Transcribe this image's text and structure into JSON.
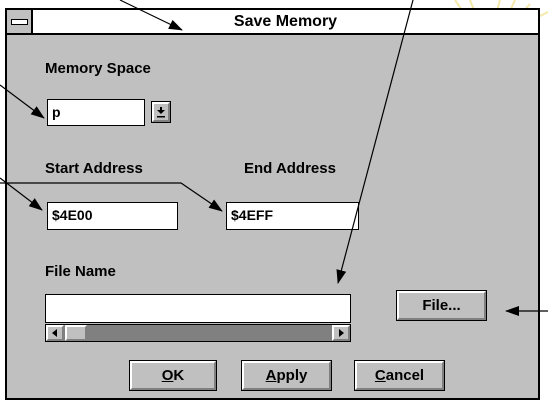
{
  "window": {
    "title": "Save Memory"
  },
  "memory_space": {
    "label": "Memory Space",
    "value": "p"
  },
  "start_address": {
    "label": "Start Address",
    "value": "$4E00"
  },
  "end_address": {
    "label": "End Address",
    "value": "$4EFF"
  },
  "file_name": {
    "label": "File Name",
    "value": ""
  },
  "buttons": {
    "file": "File...",
    "ok_mnemonic": "O",
    "ok_rest": "K",
    "apply_mnemonic": "A",
    "apply_rest": "pply",
    "cancel_mnemonic": "C",
    "cancel_rest": "ancel"
  },
  "icons": {
    "system_menu": "system-menu-icon",
    "dropdown": "dropdown-arrow-icon",
    "scroll_left": "scroll-left-arrow-icon",
    "scroll_right": "scroll-right-arrow-icon"
  },
  "colors": {
    "dialog_background": "#c0c0c0",
    "title_bar": "#ffffff",
    "field_background": "#ffffff",
    "scrollbar_track": "#808080",
    "annotation_sunburst": "#f5e9a8"
  }
}
